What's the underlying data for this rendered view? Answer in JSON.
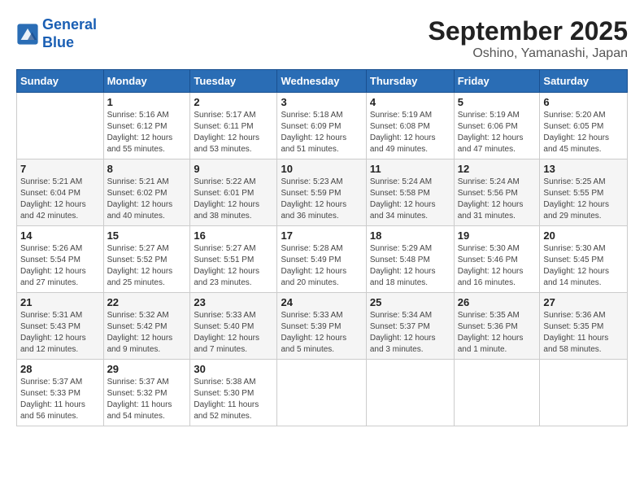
{
  "header": {
    "logo_line1": "General",
    "logo_line2": "Blue",
    "month": "September 2025",
    "location": "Oshino, Yamanashi, Japan"
  },
  "days_of_week": [
    "Sunday",
    "Monday",
    "Tuesday",
    "Wednesday",
    "Thursday",
    "Friday",
    "Saturday"
  ],
  "weeks": [
    [
      {
        "day": "",
        "info": ""
      },
      {
        "day": "1",
        "info": "Sunrise: 5:16 AM\nSunset: 6:12 PM\nDaylight: 12 hours\nand 55 minutes."
      },
      {
        "day": "2",
        "info": "Sunrise: 5:17 AM\nSunset: 6:11 PM\nDaylight: 12 hours\nand 53 minutes."
      },
      {
        "day": "3",
        "info": "Sunrise: 5:18 AM\nSunset: 6:09 PM\nDaylight: 12 hours\nand 51 minutes."
      },
      {
        "day": "4",
        "info": "Sunrise: 5:19 AM\nSunset: 6:08 PM\nDaylight: 12 hours\nand 49 minutes."
      },
      {
        "day": "5",
        "info": "Sunrise: 5:19 AM\nSunset: 6:06 PM\nDaylight: 12 hours\nand 47 minutes."
      },
      {
        "day": "6",
        "info": "Sunrise: 5:20 AM\nSunset: 6:05 PM\nDaylight: 12 hours\nand 45 minutes."
      }
    ],
    [
      {
        "day": "7",
        "info": "Sunrise: 5:21 AM\nSunset: 6:04 PM\nDaylight: 12 hours\nand 42 minutes."
      },
      {
        "day": "8",
        "info": "Sunrise: 5:21 AM\nSunset: 6:02 PM\nDaylight: 12 hours\nand 40 minutes."
      },
      {
        "day": "9",
        "info": "Sunrise: 5:22 AM\nSunset: 6:01 PM\nDaylight: 12 hours\nand 38 minutes."
      },
      {
        "day": "10",
        "info": "Sunrise: 5:23 AM\nSunset: 5:59 PM\nDaylight: 12 hours\nand 36 minutes."
      },
      {
        "day": "11",
        "info": "Sunrise: 5:24 AM\nSunset: 5:58 PM\nDaylight: 12 hours\nand 34 minutes."
      },
      {
        "day": "12",
        "info": "Sunrise: 5:24 AM\nSunset: 5:56 PM\nDaylight: 12 hours\nand 31 minutes."
      },
      {
        "day": "13",
        "info": "Sunrise: 5:25 AM\nSunset: 5:55 PM\nDaylight: 12 hours\nand 29 minutes."
      }
    ],
    [
      {
        "day": "14",
        "info": "Sunrise: 5:26 AM\nSunset: 5:54 PM\nDaylight: 12 hours\nand 27 minutes."
      },
      {
        "day": "15",
        "info": "Sunrise: 5:27 AM\nSunset: 5:52 PM\nDaylight: 12 hours\nand 25 minutes."
      },
      {
        "day": "16",
        "info": "Sunrise: 5:27 AM\nSunset: 5:51 PM\nDaylight: 12 hours\nand 23 minutes."
      },
      {
        "day": "17",
        "info": "Sunrise: 5:28 AM\nSunset: 5:49 PM\nDaylight: 12 hours\nand 20 minutes."
      },
      {
        "day": "18",
        "info": "Sunrise: 5:29 AM\nSunset: 5:48 PM\nDaylight: 12 hours\nand 18 minutes."
      },
      {
        "day": "19",
        "info": "Sunrise: 5:30 AM\nSunset: 5:46 PM\nDaylight: 12 hours\nand 16 minutes."
      },
      {
        "day": "20",
        "info": "Sunrise: 5:30 AM\nSunset: 5:45 PM\nDaylight: 12 hours\nand 14 minutes."
      }
    ],
    [
      {
        "day": "21",
        "info": "Sunrise: 5:31 AM\nSunset: 5:43 PM\nDaylight: 12 hours\nand 12 minutes."
      },
      {
        "day": "22",
        "info": "Sunrise: 5:32 AM\nSunset: 5:42 PM\nDaylight: 12 hours\nand 9 minutes."
      },
      {
        "day": "23",
        "info": "Sunrise: 5:33 AM\nSunset: 5:40 PM\nDaylight: 12 hours\nand 7 minutes."
      },
      {
        "day": "24",
        "info": "Sunrise: 5:33 AM\nSunset: 5:39 PM\nDaylight: 12 hours\nand 5 minutes."
      },
      {
        "day": "25",
        "info": "Sunrise: 5:34 AM\nSunset: 5:37 PM\nDaylight: 12 hours\nand 3 minutes."
      },
      {
        "day": "26",
        "info": "Sunrise: 5:35 AM\nSunset: 5:36 PM\nDaylight: 12 hours\nand 1 minute."
      },
      {
        "day": "27",
        "info": "Sunrise: 5:36 AM\nSunset: 5:35 PM\nDaylight: 11 hours\nand 58 minutes."
      }
    ],
    [
      {
        "day": "28",
        "info": "Sunrise: 5:37 AM\nSunset: 5:33 PM\nDaylight: 11 hours\nand 56 minutes."
      },
      {
        "day": "29",
        "info": "Sunrise: 5:37 AM\nSunset: 5:32 PM\nDaylight: 11 hours\nand 54 minutes."
      },
      {
        "day": "30",
        "info": "Sunrise: 5:38 AM\nSunset: 5:30 PM\nDaylight: 11 hours\nand 52 minutes."
      },
      {
        "day": "",
        "info": ""
      },
      {
        "day": "",
        "info": ""
      },
      {
        "day": "",
        "info": ""
      },
      {
        "day": "",
        "info": ""
      }
    ]
  ]
}
